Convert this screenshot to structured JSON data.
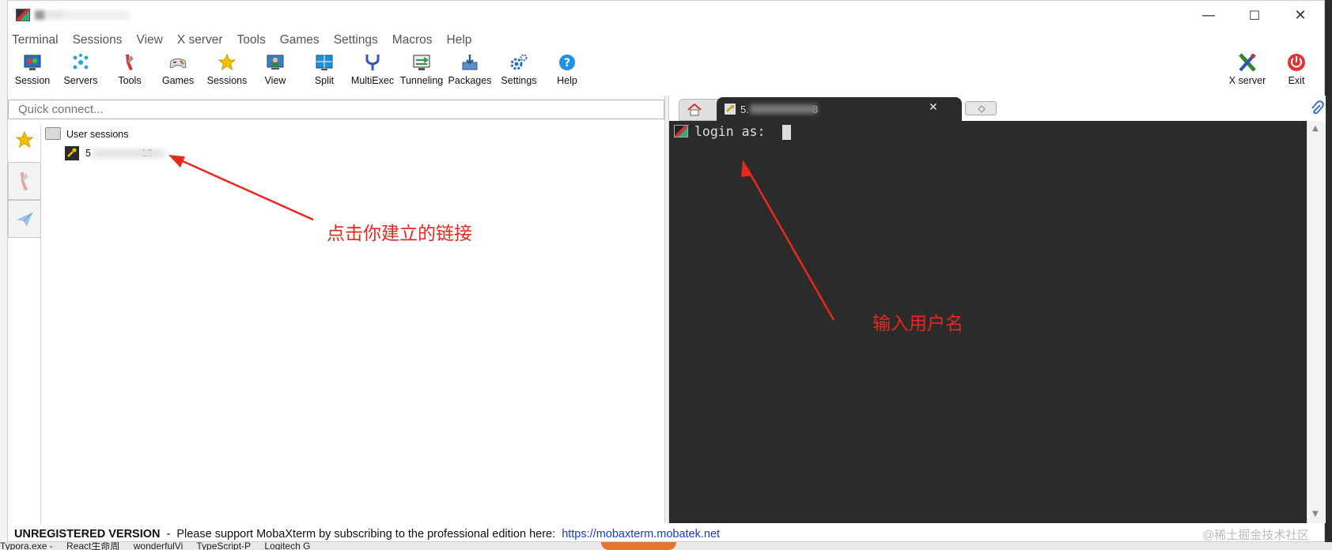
{
  "menu": [
    "Terminal",
    "Sessions",
    "View",
    "X server",
    "Tools",
    "Games",
    "Settings",
    "Macros",
    "Help"
  ],
  "toolbar": {
    "items": [
      {
        "label": "Session",
        "icon": "session-icon"
      },
      {
        "label": "Servers",
        "icon": "servers-icon"
      },
      {
        "label": "Tools",
        "icon": "tools-icon"
      },
      {
        "label": "Games",
        "icon": "games-icon"
      },
      {
        "label": "Sessions",
        "icon": "sessions-star-icon"
      },
      {
        "label": "View",
        "icon": "view-icon"
      },
      {
        "label": "Split",
        "icon": "split-icon"
      },
      {
        "label": "MultiExec",
        "icon": "multiexec-icon"
      },
      {
        "label": "Tunneling",
        "icon": "tunneling-icon"
      },
      {
        "label": "Packages",
        "icon": "packages-icon"
      },
      {
        "label": "Settings",
        "icon": "settings-icon"
      },
      {
        "label": "Help",
        "icon": "help-icon"
      }
    ],
    "xserver_label": "X server",
    "exit_label": "Exit"
  },
  "quick_connect": {
    "placeholder": "Quick connect..."
  },
  "sessions_tree": {
    "root_label": "User sessions",
    "child_label_start": "5",
    "child_label_end": "13"
  },
  "terminal_tab": {
    "label_start": "5.",
    "label_end": "8"
  },
  "terminal": {
    "prompt": "login as: "
  },
  "status": {
    "unregistered": "UNREGISTERED VERSION",
    "separator": "-",
    "message": "Please support MobaXterm by subscribing to the professional edition here:",
    "link": "https://mobaxterm.mobatek.net"
  },
  "watermark": "@稀土掘金技术社区",
  "annotations": {
    "left": "点击你建立的链接",
    "right": "输入用户名"
  },
  "taskbar": [
    "Typora.exe -",
    "React生命周",
    "wonderfulVi",
    "TypeScript-P",
    "Logitech G"
  ],
  "colors": {
    "terminal_bg": "#2b2b2b",
    "annotation": "#e8281e",
    "link": "#1a3cc8"
  }
}
